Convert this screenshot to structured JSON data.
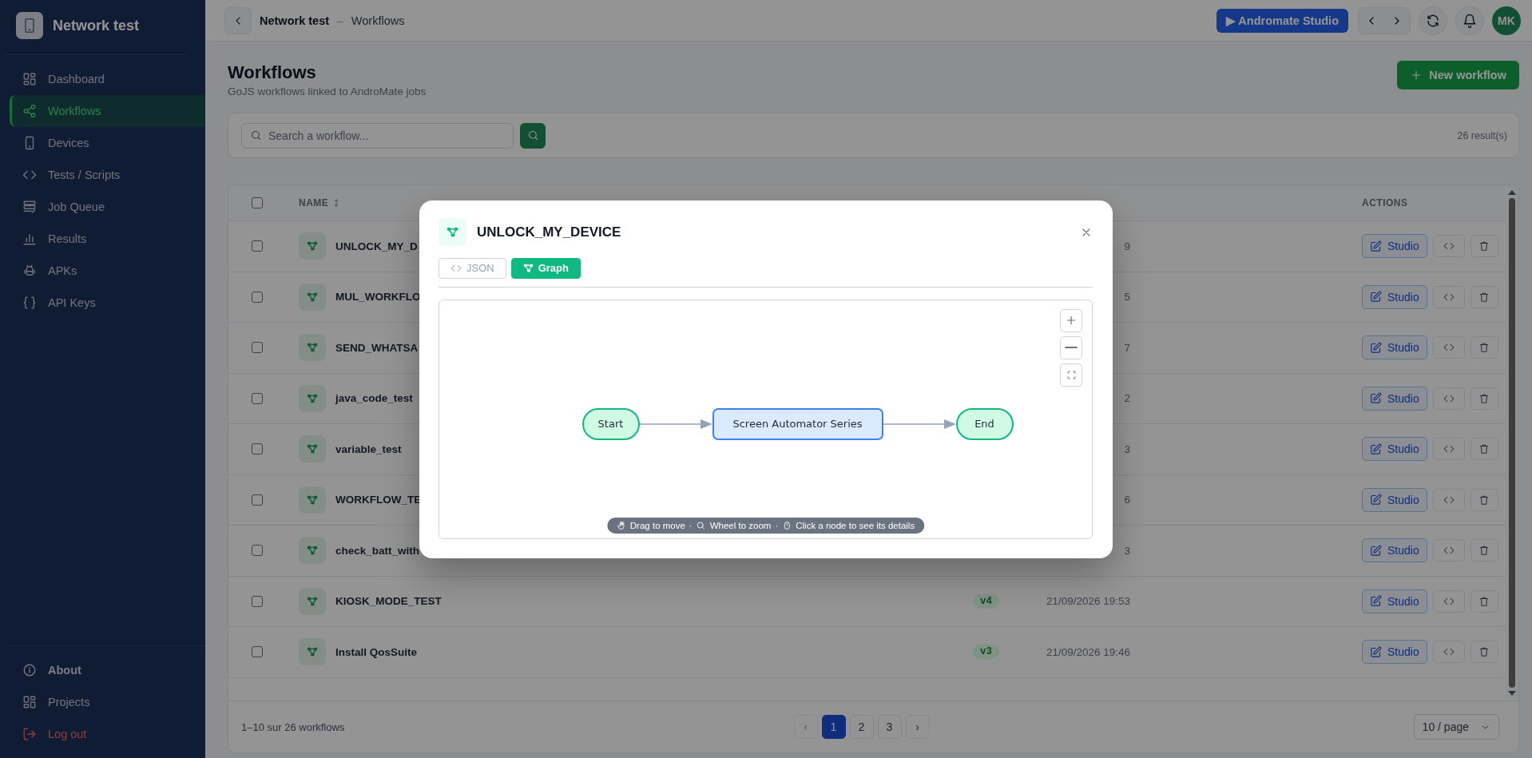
{
  "sidebar": {
    "brand": "Network test",
    "items": [
      {
        "label": "Dashboard",
        "selected": false
      },
      {
        "label": "Workflows",
        "selected": true
      },
      {
        "label": "Devices",
        "selected": false
      },
      {
        "label": "Tests / Scripts",
        "selected": false
      },
      {
        "label": "Job Queue",
        "selected": false
      },
      {
        "label": "Results",
        "selected": false
      },
      {
        "label": "APKs",
        "selected": false
      },
      {
        "label": "API Keys",
        "selected": false
      }
    ],
    "footer_items": [
      {
        "label": "About",
        "kind": "info"
      },
      {
        "label": "Projects",
        "kind": "normal"
      },
      {
        "label": "Log out",
        "kind": "danger"
      }
    ]
  },
  "header": {
    "breadcrumb": [
      {
        "label": "Network test",
        "current": false
      },
      {
        "label": "Workflows",
        "current": true
      }
    ],
    "separator": "–",
    "studio_button": "▶ Andromate Studio",
    "avatar": "MK"
  },
  "page": {
    "title": "Workflows",
    "subtitle": "GoJS workflows linked to AndroMate jobs",
    "new_button": "New workflow"
  },
  "search": {
    "placeholder": "Search a workflow...",
    "results": "26 result(s)"
  },
  "table": {
    "select_all": {
      "checked": false
    },
    "columns": [
      {
        "label": "NAME",
        "sortable": true
      },
      {
        "label": "ACTIONS",
        "sortable": false
      }
    ],
    "rows": [
      {
        "name": "UNLOCK_MY_D",
        "date": "9",
        "checked": false,
        "action": "Studio"
      },
      {
        "name": "MUL_WORKFLO",
        "date": "5",
        "checked": false,
        "action": "Studio"
      },
      {
        "name": "SEND_WHATSA",
        "date": "7",
        "checked": false,
        "action": "Studio"
      },
      {
        "name": "java_code_test",
        "date": "2",
        "checked": false,
        "action": "Studio"
      },
      {
        "name": "variable_test",
        "date": "3",
        "checked": false,
        "action": "Studio"
      },
      {
        "name": "WORKFLOW_TE",
        "date": "6",
        "checked": false,
        "action": "Studio"
      },
      {
        "name": "check_batt_with",
        "date": "3",
        "checked": false,
        "action": "Studio"
      },
      {
        "name": "KIOSK_MODE_TEST",
        "version": "v4",
        "date": "21/09/2026 19:53",
        "checked": false,
        "action": "Studio"
      },
      {
        "name": "Install QosSuite",
        "version": "v3",
        "date": "21/09/2026 19:46",
        "checked": false,
        "action": "Studio"
      }
    ],
    "footer": {
      "summary": "1–10 sur 26 workflows",
      "prev": {
        "label": "‹",
        "disabled": true
      },
      "pages": [
        {
          "label": "1",
          "selected": true
        },
        {
          "label": "2",
          "selected": false
        },
        {
          "label": "3",
          "selected": false
        }
      ],
      "next": {
        "label": "›",
        "disabled": false
      },
      "page_size": "10 / page"
    }
  },
  "modal": {
    "title": "UNLOCK_MY_DEVICE",
    "tabs": [
      {
        "label": "JSON",
        "selected": false
      },
      {
        "label": "Graph",
        "selected": true
      }
    ],
    "graph": {
      "nodes": [
        {
          "label": "Start",
          "kind": "terminal"
        },
        {
          "label": "Screen Automator Series",
          "kind": "step"
        },
        {
          "label": "End",
          "kind": "terminal"
        }
      ],
      "hints": [
        "Drag to move",
        "Wheel to zoom",
        "Click a node to see its details"
      ],
      "hint_separators": [
        "·",
        "·"
      ]
    }
  }
}
